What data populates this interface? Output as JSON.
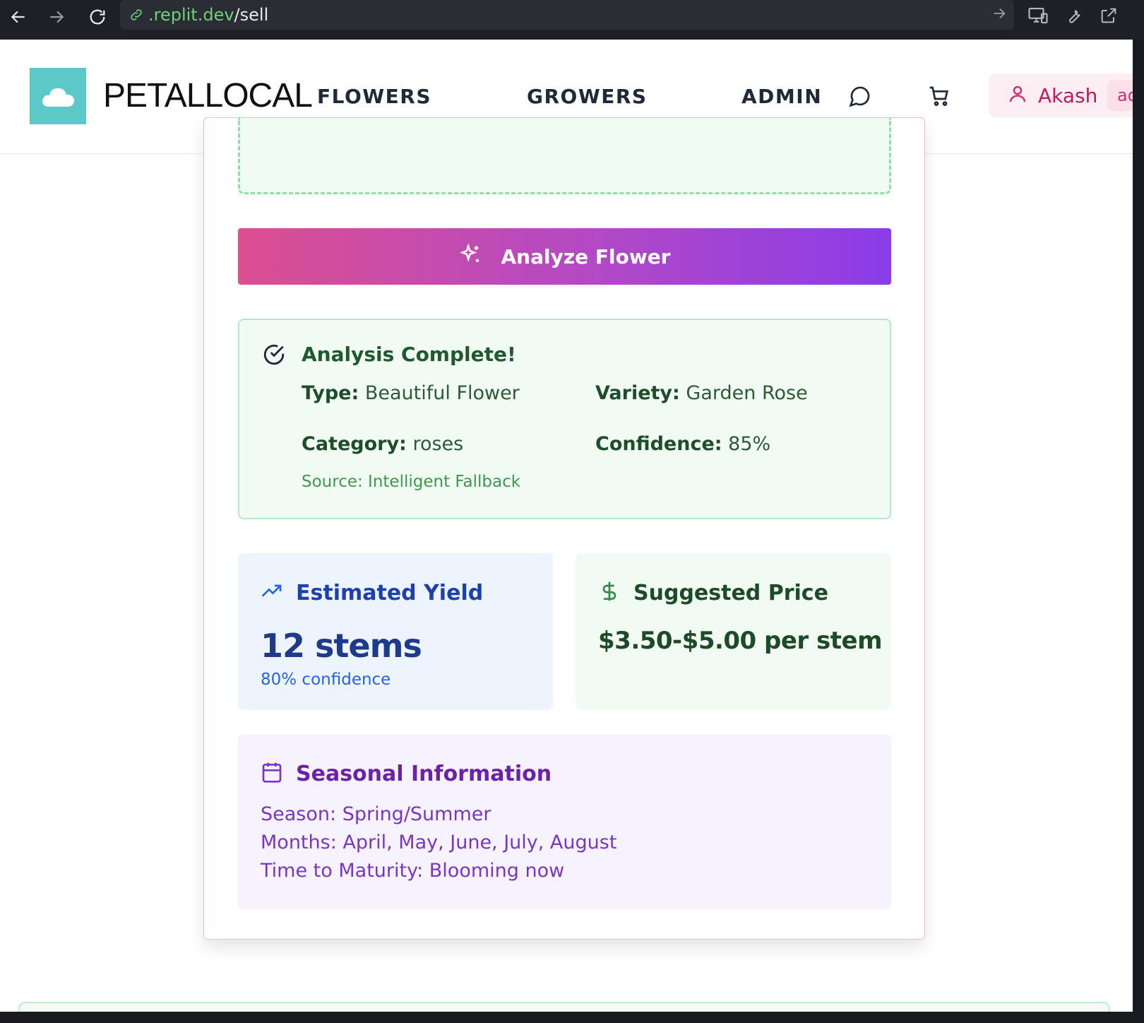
{
  "browser": {
    "url_host": ".replit.dev",
    "url_path": "/sell",
    "icons": [
      "back-arrow-icon",
      "forward-arrow-icon",
      "reload-icon",
      "link-icon",
      "go-arrow-icon",
      "devices-icon",
      "wrench-icon",
      "external-link-icon"
    ]
  },
  "header": {
    "brand": "PETALLOCAL",
    "nav": [
      "FLOWERS",
      "GROWERS",
      "ADMIN"
    ],
    "user_name": "Akash",
    "user_badge": "admin"
  },
  "analyze_button": {
    "label": "Analyze Flower"
  },
  "analysis": {
    "title": "Analysis Complete!",
    "type_label": "Type:",
    "type_value": "Beautiful Flower",
    "variety_label": "Variety:",
    "variety_value": "Garden Rose",
    "category_label": "Category:",
    "category_value": "roses",
    "confidence_label": "Confidence:",
    "confidence_value": "85%",
    "source": "Source: Intelligent Fallback"
  },
  "yield": {
    "title": "Estimated Yield",
    "value": "12 stems",
    "confidence": "80% confidence"
  },
  "price": {
    "title": "Suggested Price",
    "value": "$3.50-$5.00 per stem"
  },
  "season": {
    "title": "Seasonal Information",
    "season_label": "Season:",
    "season_value": "Spring/Summer",
    "months_label": "Months:",
    "months_value": "April, May, June, July, August",
    "maturity_label": "Time to Maturity:",
    "maturity_value": "Blooming now"
  },
  "colors": {
    "brand_teal": "#5cc8c8",
    "gradient_start": "#dc4f91",
    "gradient_end": "#8b3ce8",
    "success_green": "#1f5a2e",
    "yield_blue": "#1e3a8a",
    "season_purple": "#7a35c8"
  }
}
